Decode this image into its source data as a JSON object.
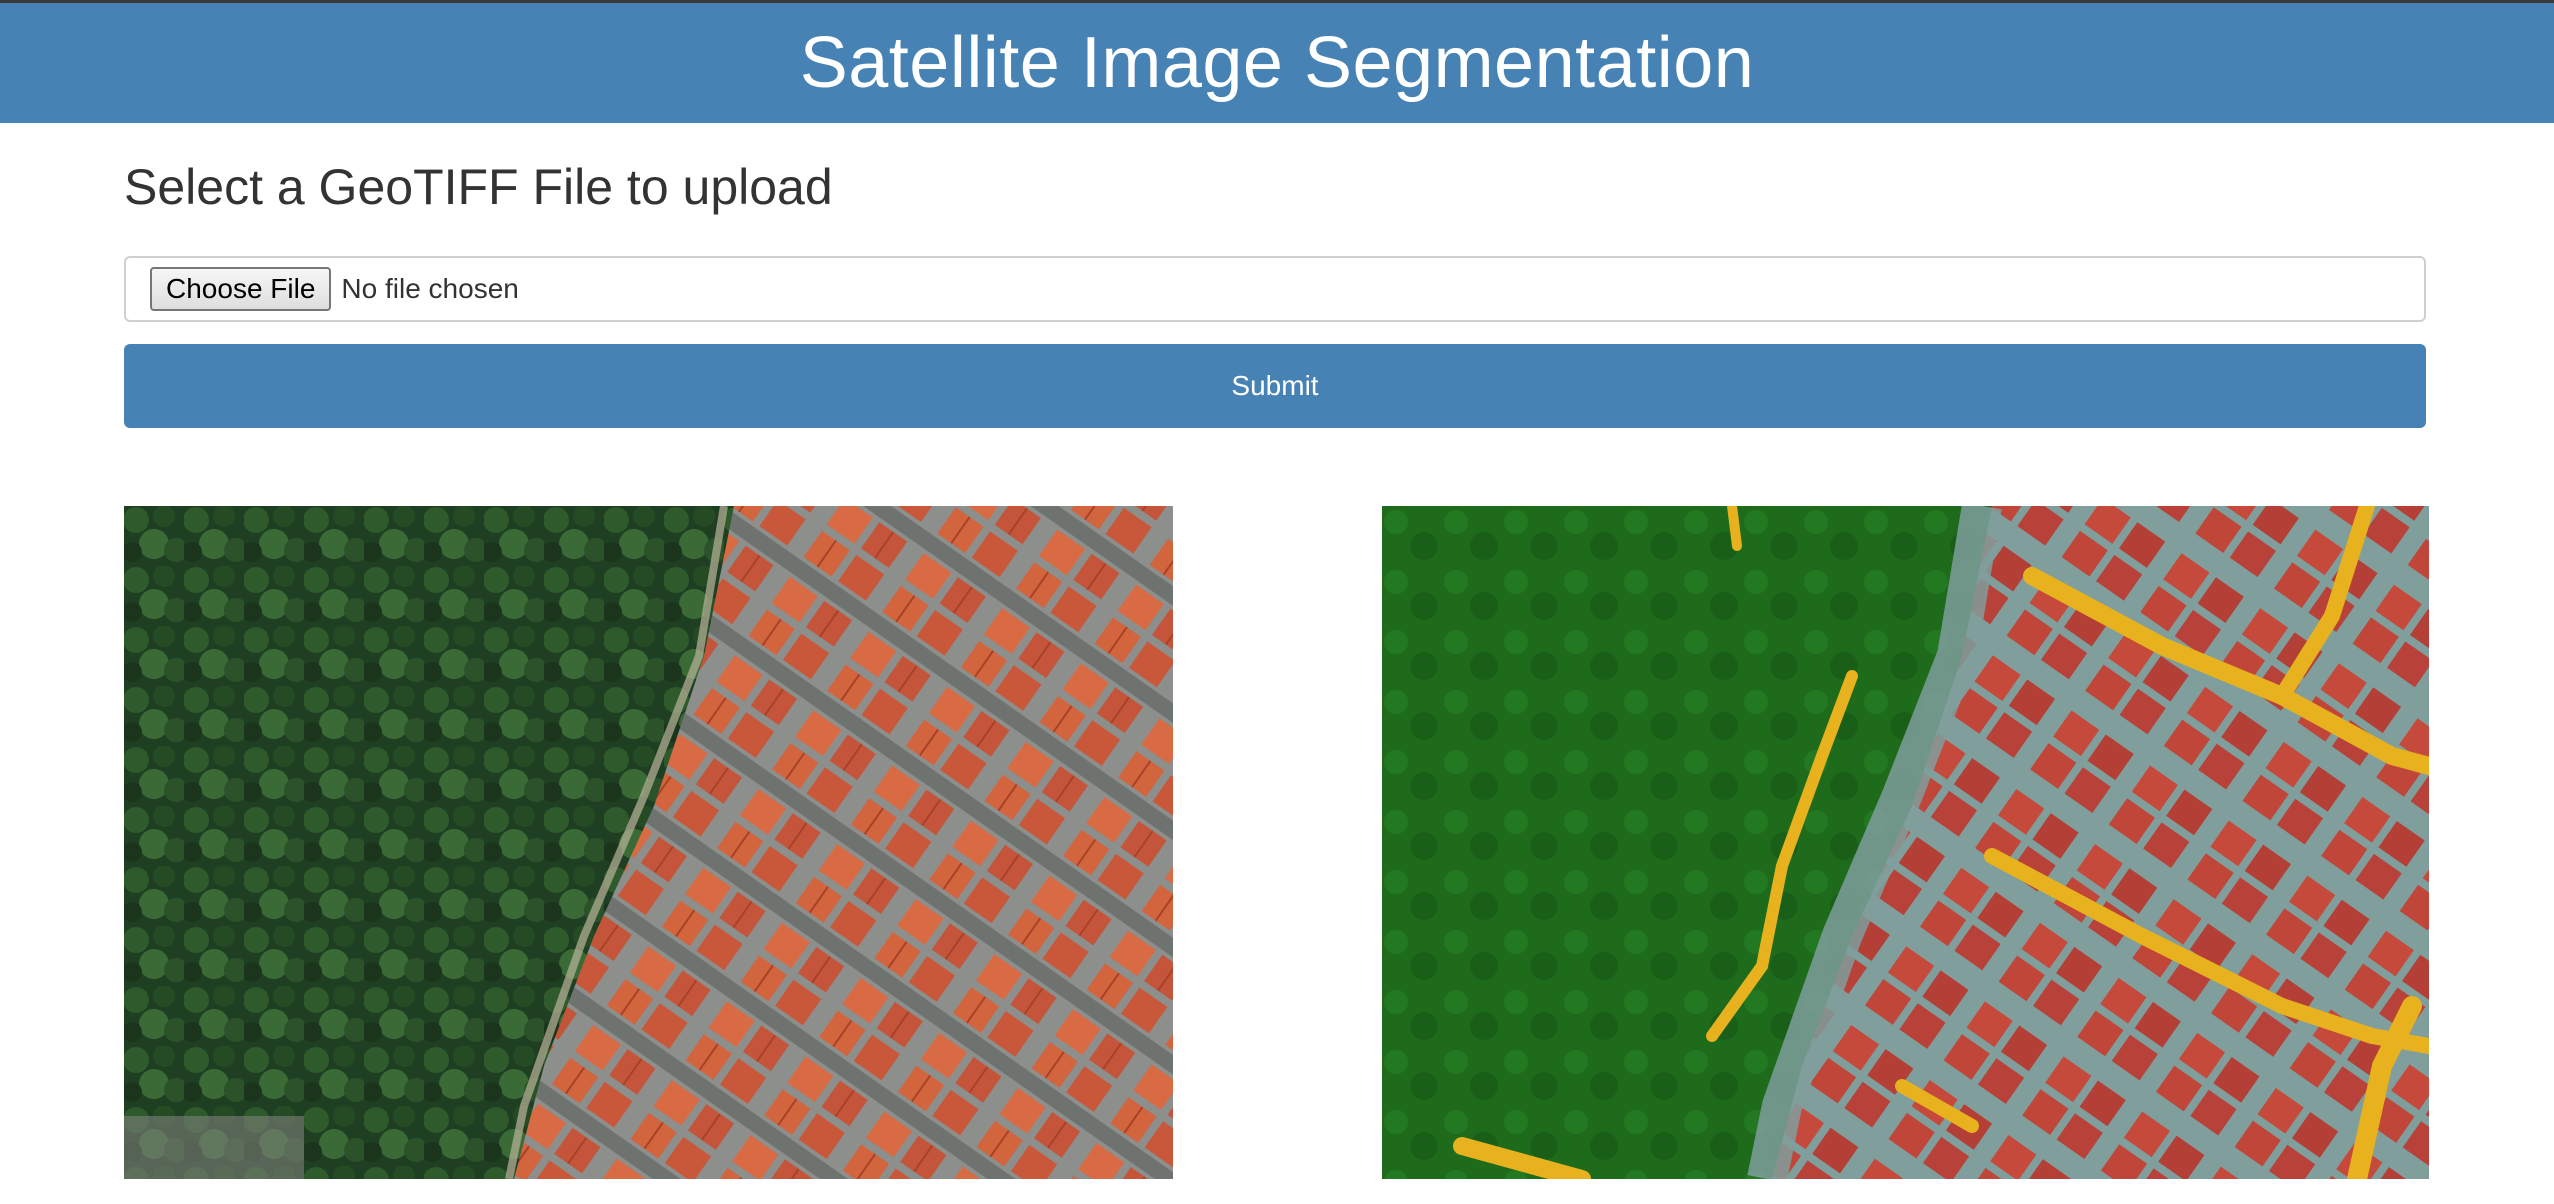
{
  "page": {
    "title": "Satellite Image Segmentation",
    "subtitle": "Select a GeoTIFF File to upload"
  },
  "upload": {
    "choose_label": "Choose File",
    "status_text": "No file chosen",
    "submit_label": "Submit"
  },
  "images": {
    "original": {
      "name": "original-satellite-image"
    },
    "segmented": {
      "name": "segmentation-mask-overlay"
    }
  },
  "colors": {
    "header": "#4682b4",
    "submit": "#4682b4",
    "vegetation": "#1e7a1e",
    "building": "#c0392b",
    "road": "#e8b21e",
    "background": "#7f9e9c"
  }
}
